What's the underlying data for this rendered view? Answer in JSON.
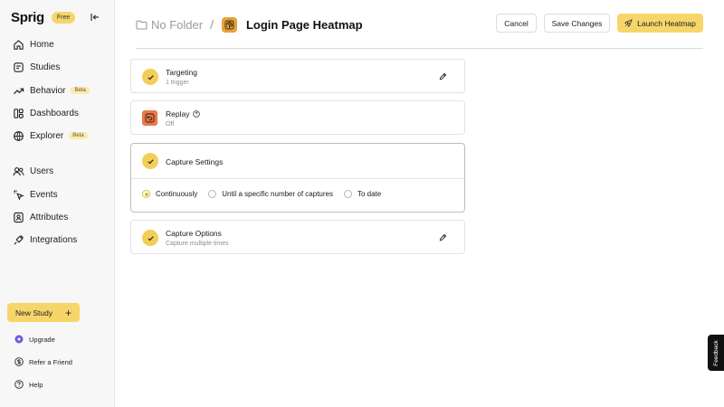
{
  "app": {
    "logo": "Sprig",
    "plan_badge": "Free"
  },
  "sidebar": {
    "items": [
      {
        "label": "Home"
      },
      {
        "label": "Studies"
      },
      {
        "label": "Behavior",
        "badge": "Beta"
      },
      {
        "label": "Dashboards"
      },
      {
        "label": "Explorer",
        "badge": "Beta"
      },
      {
        "label": "Users"
      },
      {
        "label": "Events"
      },
      {
        "label": "Attributes"
      },
      {
        "label": "Integrations"
      }
    ],
    "new_study": "New Study",
    "footer": [
      {
        "label": "Upgrade"
      },
      {
        "label": "Refer a Friend"
      },
      {
        "label": "Help"
      }
    ]
  },
  "header": {
    "folder": "No Folder",
    "separator": "/",
    "title": "Login Page Heatmap",
    "cancel": "Cancel",
    "save": "Save Changes",
    "launch": "Launch Heatmap"
  },
  "cards": {
    "targeting": {
      "title": "Targeting",
      "subtitle": "1 trigger"
    },
    "replay": {
      "title": "Replay",
      "subtitle": "Off"
    },
    "capture_settings": {
      "title": "Capture Settings",
      "options": [
        "Continuously",
        "Until a specific number of captures",
        "To date"
      ],
      "selected": "Continuously"
    },
    "capture_options": {
      "title": "Capture Options",
      "subtitle": "Capture multiple times"
    }
  },
  "feedback": "Feedback",
  "colors": {
    "accent": "#f6d66a",
    "check": "#f1cf57",
    "replay": "#e8784c",
    "study_icon": "#e8a13a"
  }
}
